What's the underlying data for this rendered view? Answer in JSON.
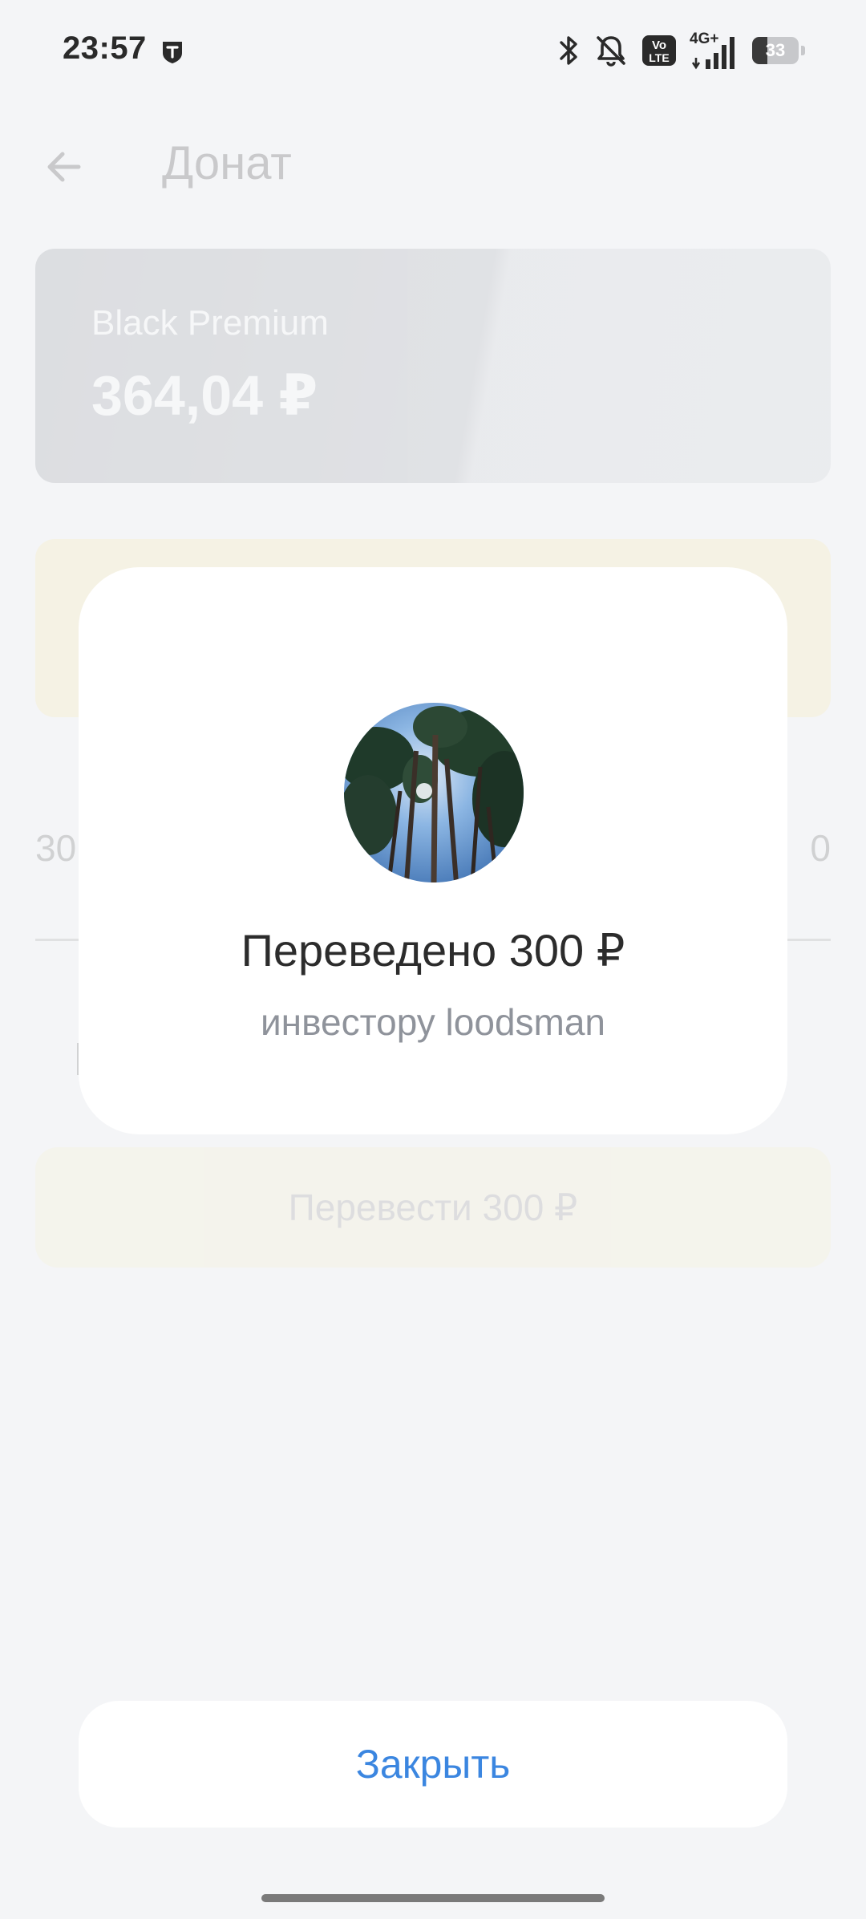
{
  "status_bar": {
    "time": "23:57",
    "app_icon": "tinkoff-shield-icon",
    "icons": [
      "bluetooth-icon",
      "muted-bell-icon",
      "volte-icon",
      "signal-icon"
    ],
    "network_type": "4G+",
    "volte_label": "Vo LTE",
    "battery_level": "33"
  },
  "background": {
    "title": "Донат",
    "card": {
      "name": "Black Premium",
      "balance": "364,04 ₽"
    },
    "amount_left": "30",
    "amount_right": "0",
    "transfer_button_label": "Перевести 300 ₽"
  },
  "dialog": {
    "title": "Переведено 300 ₽",
    "subtitle": "инвестору loodsman",
    "avatar": "recipient-avatar-pine-trees"
  },
  "close_button": {
    "label": "Закрыть"
  },
  "colors": {
    "page_background": "#f4f5f7",
    "dialog_background": "#ffffff",
    "accent_link": "#3b86e0",
    "subtitle_gray": "#8f939b"
  }
}
